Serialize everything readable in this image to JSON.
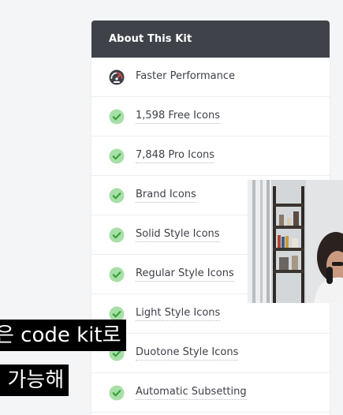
{
  "panel": {
    "title": "About This Kit",
    "features": [
      {
        "label": "Faster Performance",
        "icon": "speedometer-icon"
      },
      {
        "label": "1,598 Free Icons",
        "icon": "check-circle-icon"
      },
      {
        "label": "7,848 Pro Icons",
        "icon": "check-circle-icon"
      },
      {
        "label": "Brand Icons",
        "icon": "check-circle-icon"
      },
      {
        "label": "Solid Style Icons",
        "icon": "check-circle-icon"
      },
      {
        "label": "Regular Style Icons",
        "icon": "check-circle-icon"
      },
      {
        "label": "Light Style Icons",
        "icon": "check-circle-icon"
      },
      {
        "label": "Duotone Style Icons",
        "icon": "check-circle-icon"
      },
      {
        "label": "Automatic Subsetting",
        "icon": "check-circle-icon"
      }
    ]
  },
  "subtitles": {
    "line1": "은 code kit로",
    "line2": "l 가능해"
  },
  "colors": {
    "header_bg": "#3f4349",
    "check_green": "#5cb85c",
    "check_bg": "#a8dfa8"
  }
}
